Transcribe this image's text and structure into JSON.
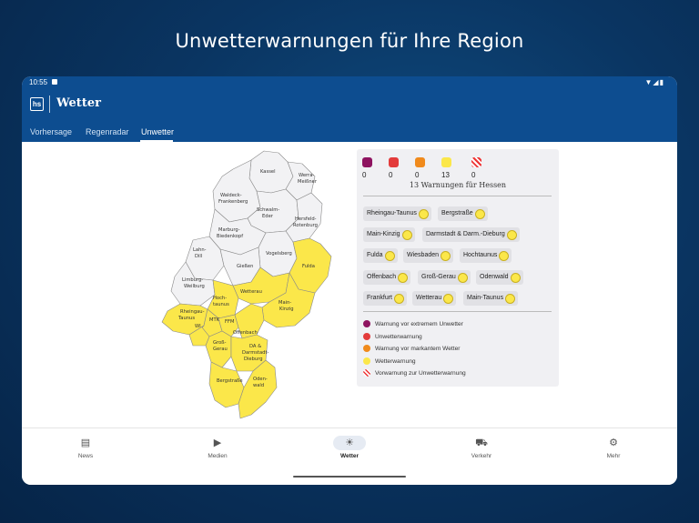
{
  "headline": "Unwetterwarnungen für Ihre Region",
  "statusbar": {
    "time": "10:55",
    "icons": "▼◢▮"
  },
  "appbar": {
    "logo": "hs",
    "title": "Wetter"
  },
  "tabs": [
    {
      "label": "Vorhersage"
    },
    {
      "label": "Regenradar"
    },
    {
      "label": "Unwetter",
      "active": true
    }
  ],
  "map": {
    "regions": [
      {
        "label": "Kassel",
        "warned": false
      },
      {
        "label": "Waldeck-Frankenberg",
        "warned": false
      },
      {
        "label": "Werra-Meißner",
        "warned": false
      },
      {
        "label": "Schwalm-Eder",
        "warned": false
      },
      {
        "label": "Hersfeld-Rotenburg",
        "warned": false
      },
      {
        "label": "Marburg-Biedenkopf",
        "warned": false
      },
      {
        "label": "Lahn-Dill",
        "warned": false
      },
      {
        "label": "Vogelsberg",
        "warned": false
      },
      {
        "label": "Fulda",
        "warned": true
      },
      {
        "label": "Gießen",
        "warned": false
      },
      {
        "label": "Limburg-Weilburg",
        "warned": false
      },
      {
        "label": "Wetterau",
        "warned": true
      },
      {
        "label": "Hoch-taunus",
        "warned": true
      },
      {
        "label": "Main-Kinzig",
        "warned": true
      },
      {
        "label": "Rheingau-Taunus",
        "warned": true
      },
      {
        "label": "MTK",
        "warned": true
      },
      {
        "label": "FFM",
        "warned": true
      },
      {
        "label": "WI",
        "warned": true
      },
      {
        "label": "Offenbach",
        "warned": true
      },
      {
        "label": "Groß-Gerau",
        "warned": true
      },
      {
        "label": "DA & Darmstadt-Dieburg",
        "warned": true
      },
      {
        "label": "Bergstraße",
        "warned": true
      },
      {
        "label": "Oden-wald",
        "warned": true
      }
    ],
    "colors": {
      "warned": "#fbe74a",
      "neutral": "#f2f2f4",
      "border": "#8a8a8a"
    }
  },
  "panel": {
    "counts": [
      {
        "value": "0",
        "color": "#8e1360",
        "level": "extreme"
      },
      {
        "value": "0",
        "color": "#e33b3b",
        "level": "unwetter"
      },
      {
        "value": "0",
        "color": "#f08a1c",
        "level": "markant"
      },
      {
        "value": "13",
        "color": "#fbe74a",
        "level": "wetter"
      },
      {
        "value": "0",
        "color": "hatch",
        "level": "vorwarnung"
      }
    ],
    "total_text": "13 Warnungen für Hessen",
    "chips": [
      "Rheingau-Taunus",
      "Bergstraße",
      "Main-Kinzig",
      "Darmstadt & Darm.-Dieburg",
      "Fulda",
      "Wiesbaden",
      "Hochtaunus",
      "Offenbach",
      "Groß-Gerau",
      "Odenwald",
      "Frankfurt",
      "Wetterau",
      "Main-Taunus"
    ],
    "legend": [
      {
        "label": "Warnung vor extremem Unwetter",
        "color": "#8e1360"
      },
      {
        "label": "Unwetterwarnung",
        "color": "#e33b3b"
      },
      {
        "label": "Warnung vor markantem Wetter",
        "color": "#f08a1c"
      },
      {
        "label": "Wetterwarnung",
        "color": "#fbe74a"
      },
      {
        "label": "Vorwarnung zur Unwetterwarnung",
        "color": "hatch"
      }
    ]
  },
  "nav": [
    {
      "label": "News",
      "icon": "newspaper-icon",
      "glyph": "▤"
    },
    {
      "label": "Medien",
      "icon": "play-icon",
      "glyph": "▶"
    },
    {
      "label": "Wetter",
      "icon": "weather-icon",
      "glyph": "☀",
      "active": true
    },
    {
      "label": "Verkehr",
      "icon": "traffic-icon",
      "glyph": "⛟"
    },
    {
      "label": "Mehr",
      "icon": "gear-icon",
      "glyph": "⚙"
    }
  ]
}
